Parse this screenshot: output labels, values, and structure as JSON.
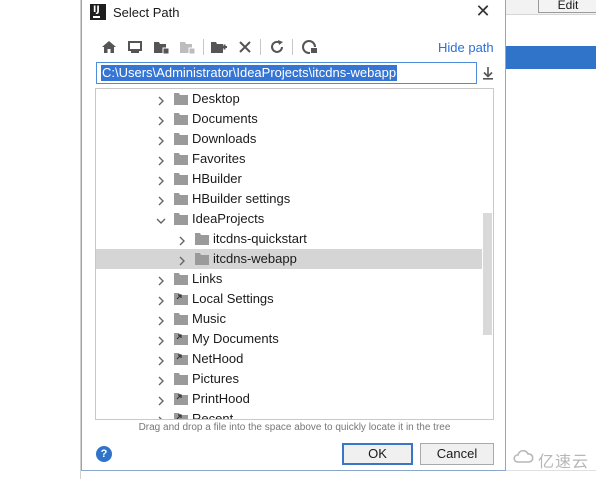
{
  "background": {
    "edit_label": "Edit"
  },
  "dialog": {
    "title": "Select Path",
    "toolbar": {
      "icons": [
        "home-icon",
        "desktop-icon",
        "project-folder-icon",
        "module-folder-icon",
        "new-folder-icon",
        "delete-icon",
        "refresh-icon",
        "show-hidden-icon"
      ],
      "hide_path_label": "Hide path"
    },
    "path_value": "C:\\Users\\Administrator\\IdeaProjects\\itcdns-webapp",
    "tree": {
      "items": [
        {
          "label": "Desktop",
          "level": 1,
          "expanded": false,
          "type": "folder"
        },
        {
          "label": "Documents",
          "level": 1,
          "expanded": false,
          "type": "folder"
        },
        {
          "label": "Downloads",
          "level": 1,
          "expanded": false,
          "type": "folder"
        },
        {
          "label": "Favorites",
          "level": 1,
          "expanded": false,
          "type": "folder"
        },
        {
          "label": "HBuilder",
          "level": 1,
          "expanded": false,
          "type": "folder"
        },
        {
          "label": "HBuilder settings",
          "level": 1,
          "expanded": false,
          "type": "folder"
        },
        {
          "label": "IdeaProjects",
          "level": 1,
          "expanded": true,
          "type": "folder"
        },
        {
          "label": "itcdns-quickstart",
          "level": 2,
          "expanded": false,
          "type": "folder"
        },
        {
          "label": "itcdns-webapp",
          "level": 2,
          "expanded": false,
          "type": "folder",
          "selected": true
        },
        {
          "label": "Links",
          "level": 1,
          "expanded": false,
          "type": "folder"
        },
        {
          "label": "Local Settings",
          "level": 1,
          "expanded": false,
          "type": "link"
        },
        {
          "label": "Music",
          "level": 1,
          "expanded": false,
          "type": "folder"
        },
        {
          "label": "My Documents",
          "level": 1,
          "expanded": false,
          "type": "link"
        },
        {
          "label": "NetHood",
          "level": 1,
          "expanded": false,
          "type": "link"
        },
        {
          "label": "Pictures",
          "level": 1,
          "expanded": false,
          "type": "folder"
        },
        {
          "label": "PrintHood",
          "level": 1,
          "expanded": false,
          "type": "link"
        },
        {
          "label": "Recent",
          "level": 1,
          "expanded": false,
          "type": "link"
        }
      ]
    },
    "hint": "Drag and drop a file into the space above to quickly locate it in the tree",
    "help_label": "?",
    "ok_label": "OK",
    "cancel_label": "Cancel"
  },
  "watermark": {
    "text": "亿速云"
  },
  "colors": {
    "accent": "#2f74c8",
    "selection_text_bg": "#3575d3",
    "selected_row": "#d5d5d5",
    "link_text": "#2c6fd6"
  }
}
